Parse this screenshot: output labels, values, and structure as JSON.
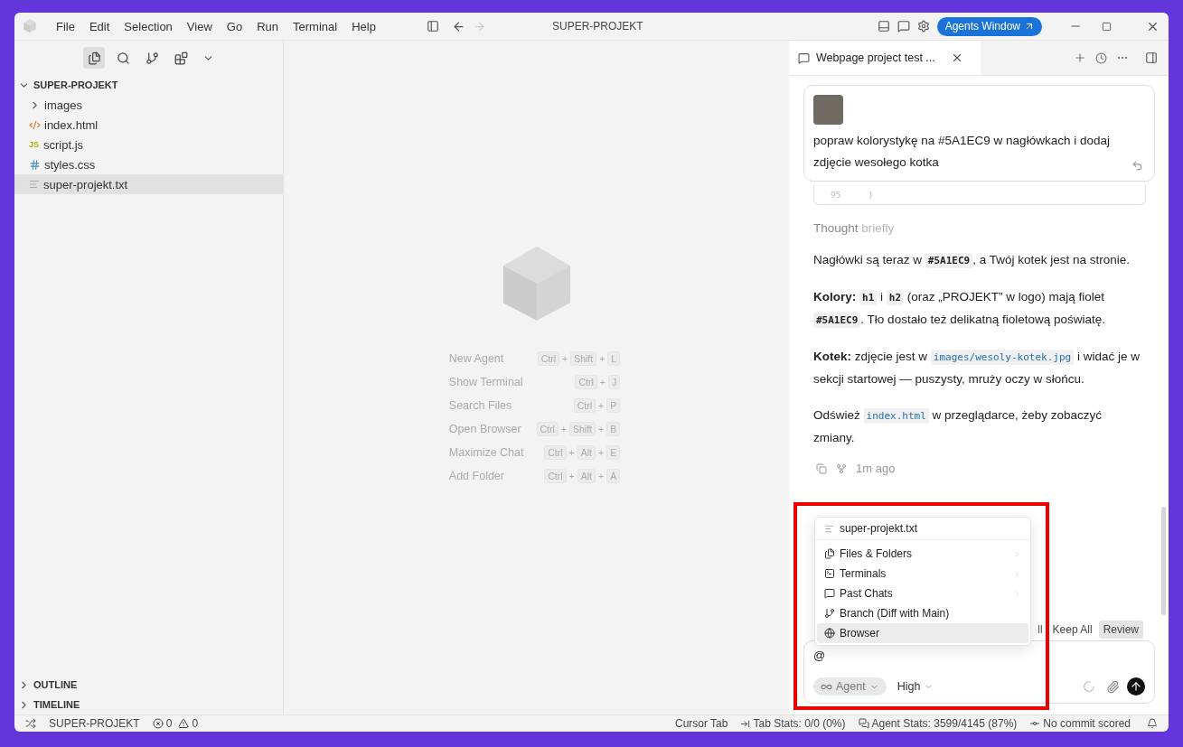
{
  "window": {
    "title": "SUPER-PROJEKT",
    "menu": [
      "File",
      "Edit",
      "Selection",
      "View",
      "Go",
      "Run",
      "Terminal",
      "Help"
    ],
    "agents_button": "Agents Window"
  },
  "sidebar": {
    "views": [
      {
        "kind": "files",
        "selected": true
      },
      {
        "kind": "search",
        "selected": false
      },
      {
        "kind": "branch",
        "selected": false
      },
      {
        "kind": "extensions",
        "selected": false
      }
    ],
    "root": {
      "label": "SUPER-PROJEKT",
      "expanded": true,
      "children": [
        {
          "label": "images",
          "kind": "folder",
          "expanded": false,
          "selected": false
        },
        {
          "label": "index.html",
          "kind": "html",
          "selected": false
        },
        {
          "label": "script.js",
          "kind": "js",
          "icon_text": "JS",
          "selected": false
        },
        {
          "label": "styles.css",
          "kind": "css",
          "selected": false
        },
        {
          "label": "super-projekt.txt",
          "kind": "txt",
          "selected": true
        }
      ]
    },
    "sections": [
      {
        "label": "OUTLINE",
        "expanded": false
      },
      {
        "label": "TIMELINE",
        "expanded": false
      }
    ]
  },
  "editor": {
    "joiner": "+",
    "shortcuts": [
      {
        "label": "New Agent",
        "keys": [
          "Ctrl",
          "Shift",
          "L"
        ]
      },
      {
        "label": "Show Terminal",
        "keys": [
          "Ctrl",
          "J"
        ]
      },
      {
        "label": "Search Files",
        "keys": [
          "Ctrl",
          "P"
        ]
      },
      {
        "label": "Open Browser",
        "keys": [
          "Ctrl",
          "Shift",
          "B"
        ]
      },
      {
        "label": "Maximize Chat",
        "keys": [
          "Ctrl",
          "Alt",
          "E"
        ]
      },
      {
        "label": "Add Folder",
        "keys": [
          "Ctrl",
          "Alt",
          "A"
        ]
      }
    ]
  },
  "chat": {
    "tab": "Webpage project test ...",
    "user_message": "popraw kolorystykę na #5A1EC9 w nagłówkach i dodaj zdjęcie wesołego kotka",
    "code_line": {
      "number": "95",
      "text": "}"
    },
    "thought": {
      "label": "Thought",
      "detail": "briefly"
    },
    "paragraphs": [
      [
        {
          "kind": "text",
          "text": "Nagłówki są teraz w "
        },
        {
          "kind": "code",
          "text": "#5A1EC9"
        },
        {
          "kind": "text",
          "text": ", a Twój kotek jest na stronie."
        }
      ],
      [
        {
          "kind": "bold",
          "text": "Kolory: "
        },
        {
          "kind": "code",
          "text": "h1"
        },
        {
          "kind": "text",
          "text": " i "
        },
        {
          "kind": "code",
          "text": "h2"
        },
        {
          "kind": "text",
          "text": " (oraz „PROJEKT” w logo) mają fiolet "
        },
        {
          "kind": "code",
          "text": "#5A1EC9"
        },
        {
          "kind": "text",
          "text": ". Tło dostało też delikatną fioletową poświatę."
        }
      ],
      [
        {
          "kind": "bold",
          "text": "Kotek:"
        },
        {
          "kind": "text",
          "text": " zdjęcie jest w "
        },
        {
          "kind": "path",
          "text": "images/wesoly-kotek.jpg"
        },
        {
          "kind": "text",
          "text": " i widać je w sekcji startowej — puszysty, mruży oczy w słońcu."
        }
      ],
      [
        {
          "kind": "text",
          "text": "Odśwież "
        },
        {
          "kind": "path",
          "text": "index.html"
        },
        {
          "kind": "text",
          "text": " w przeglądarce, żeby zobaczyć zmiany."
        }
      ]
    ],
    "timestamp": "1m ago",
    "review_bar": {
      "fragment": "ll",
      "keep": "Keep All",
      "review": "Review"
    },
    "input": {
      "value": "@",
      "mode": "Agent",
      "effort": "High"
    },
    "mention_menu": {
      "file": "super-projekt.txt",
      "items": [
        {
          "label": "Files & Folders",
          "kind": "files",
          "submenu": true,
          "selected": false
        },
        {
          "label": "Terminals",
          "kind": "terminal",
          "submenu": true,
          "selected": false
        },
        {
          "label": "Past Chats",
          "kind": "chat",
          "submenu": true,
          "selected": false
        },
        {
          "label": "Branch (Diff with Main)",
          "kind": "branch",
          "submenu": false,
          "selected": false
        },
        {
          "label": "Browser",
          "kind": "browser",
          "submenu": false,
          "selected": true
        }
      ]
    }
  },
  "status_bar": {
    "workspace": "SUPER-PROJEKT",
    "errors": "0",
    "warnings": "0",
    "cursor_tab": "Cursor Tab",
    "tab_stats": "Tab Stats: 0/0 (0%)",
    "agent_stats": "Agent Stats: 3599/4145 (87%)",
    "commit": "No commit scored"
  }
}
